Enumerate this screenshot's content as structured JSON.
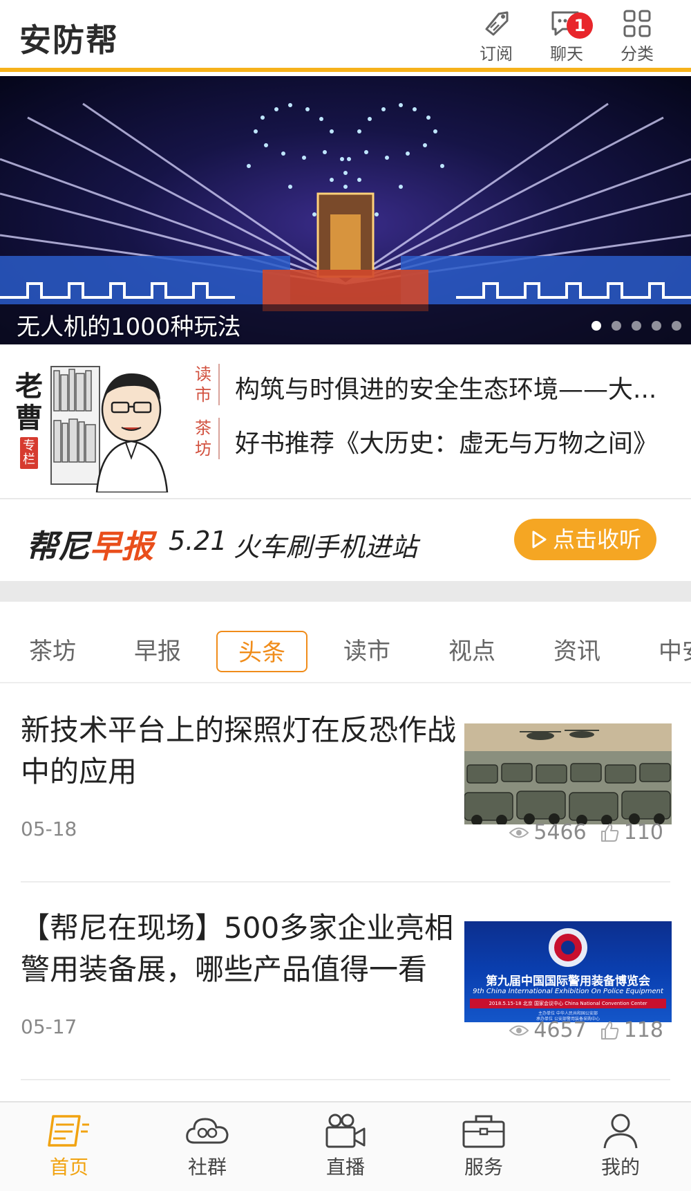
{
  "header": {
    "app_title": "安防帮",
    "subscribe_label": "订阅",
    "chat_label": "聊天",
    "chat_badge": "1",
    "category_label": "分类"
  },
  "banner": {
    "caption": "无人机的1000种玩法",
    "slide_count": 5,
    "active_slide": 1
  },
  "column": {
    "title_chars": [
      "老",
      "曹"
    ],
    "tag_chars": [
      "专",
      "栏"
    ],
    "rows": [
      {
        "category_chars": [
          "读",
          "市"
        ],
        "text": "构筑与时俱进的安全生态环境——大..."
      },
      {
        "category_chars": [
          "茶",
          "坊"
        ],
        "text": "好书推荐《大历史：虚无与万物之间》"
      }
    ]
  },
  "morning_report": {
    "brand_prefix": "帮尼",
    "brand_highlight": "早报",
    "date": "5.21",
    "headline": "火车刷手机进站",
    "listen_label": "点击收听"
  },
  "tabs": [
    {
      "label": "茶坊",
      "active": false
    },
    {
      "label": "早报",
      "active": false
    },
    {
      "label": "头条",
      "active": true
    },
    {
      "label": "读市",
      "active": false
    },
    {
      "label": "视点",
      "active": false
    },
    {
      "label": "资讯",
      "active": false
    },
    {
      "label": "中安",
      "active": false
    }
  ],
  "news": [
    {
      "title": "新技术平台上的探照灯在反恐作战中的应用",
      "date": "05-18",
      "views": "5466",
      "likes": "110",
      "thumb": "military-vehicles-image"
    },
    {
      "title": "【帮尼在现场】500多家企业亮相警用装备展，哪些产品值得一看",
      "date": "05-17",
      "views": "4657",
      "likes": "118",
      "thumb": "expo-banner-image",
      "thumb_text": {
        "line1": "第九届中国国际警用装备博览会",
        "line2": "9th China International Exhibition On Police Equipment",
        "line3": "2018.5.15-18 北京 国家会议中心 China National Convention Center",
        "line4": "主办单位 中华人民共和国公安部",
        "line5": "承办单位 公安部警用装备采购中心"
      }
    }
  ],
  "bottom_nav": [
    {
      "label": "首页",
      "icon": "home-news-icon",
      "active": true
    },
    {
      "label": "社群",
      "icon": "community-cloud-icon",
      "active": false
    },
    {
      "label": "直播",
      "icon": "video-camera-icon",
      "active": false
    },
    {
      "label": "服务",
      "icon": "briefcase-icon",
      "active": false
    },
    {
      "label": "我的",
      "icon": "user-profile-icon",
      "active": false
    }
  ],
  "colors": {
    "accent_orange": "#f5a623",
    "header_border": "#f6b21b",
    "tab_active": "#f08c1a",
    "badge_red": "#e8262b",
    "brand_red": "#e94e1b"
  }
}
